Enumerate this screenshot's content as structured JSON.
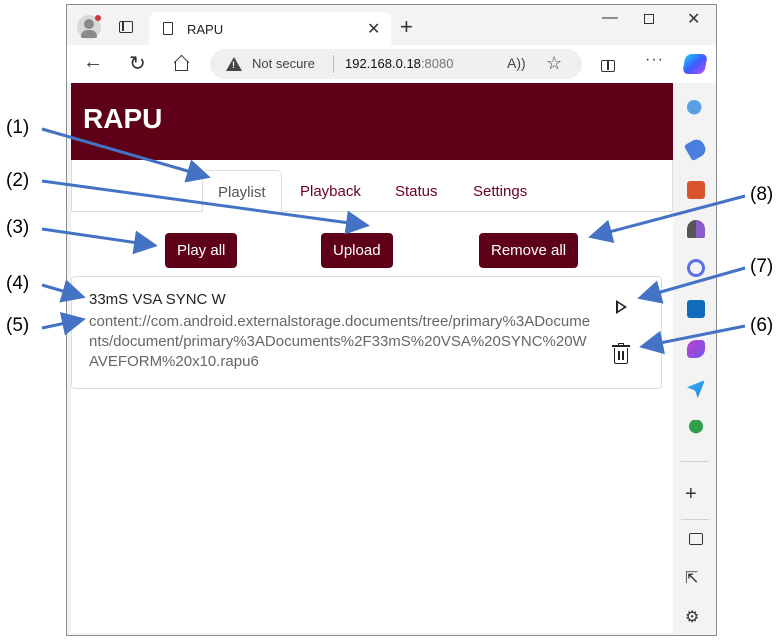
{
  "browser": {
    "tab_title": "RAPU",
    "tab_close_glyph": "✕",
    "new_tab_glyph": "+",
    "minimize_glyph": "—",
    "close_glyph": "✕",
    "back_glyph": "←",
    "reload_glyph": "↻",
    "security_text": "Not secure",
    "url_host": "192.168.0.18",
    "url_port": ":8080",
    "read_aloud_glyph": "A))",
    "favorite_glyph": "☆",
    "more_glyph": "···",
    "sidebar_add_glyph": "+",
    "sidebar_open_glyph": "⇱",
    "sidebar_settings_glyph": "⚙"
  },
  "app": {
    "title": "RAPU",
    "tabs": [
      {
        "label": "Playlist",
        "active": true
      },
      {
        "label": "Playback",
        "active": false
      },
      {
        "label": "Status",
        "active": false
      },
      {
        "label": "Settings",
        "active": false
      }
    ],
    "buttons": {
      "play_all": "Play all",
      "upload": "Upload",
      "remove_all": "Remove all"
    },
    "playlist": [
      {
        "name": "33mS VSA SYNC W",
        "path": "content://com.android.externalstorage.documents/tree/primary%3ADocuments/document/primary%3ADocuments%2F33mS%20VSA%20SYNC%20WAVEFORM%20x10.rapu6"
      }
    ]
  },
  "callouts": [
    "(1)",
    "(2)",
    "(3)",
    "(4)",
    "(5)",
    "(6)",
    "(7)",
    "(8)"
  ],
  "colors": {
    "brand": "#5f0019",
    "arrow": "#4472c4"
  }
}
